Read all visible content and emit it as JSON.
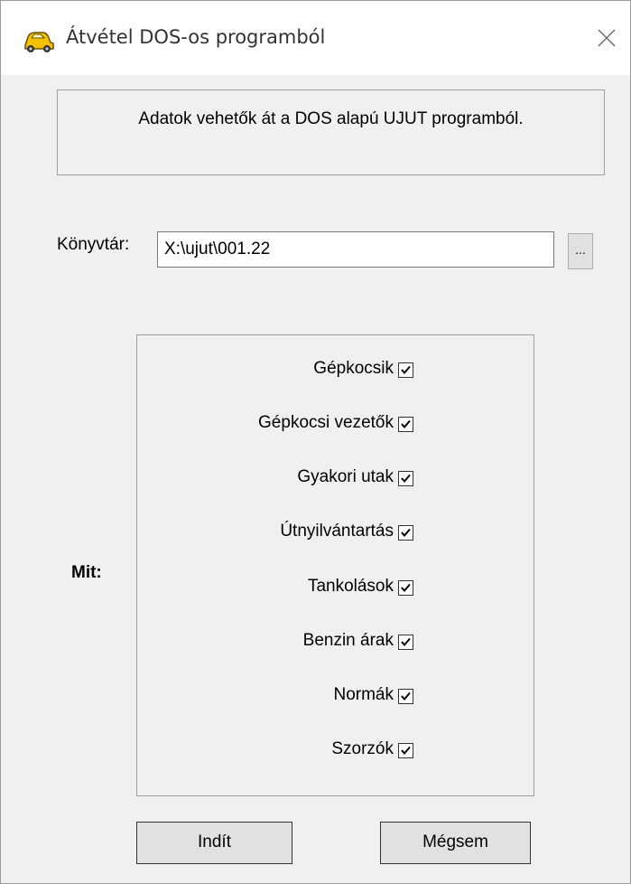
{
  "window": {
    "title": "Átvétel DOS-os programból",
    "app_icon": "car-icon",
    "close_icon": "close-icon"
  },
  "info": {
    "text": "Adatok vehetők át a DOS alapú UJUT programból."
  },
  "directory": {
    "label": "Könyvtár:",
    "value": "X:\\ujut\\001.22",
    "browse_label": "..."
  },
  "what": {
    "label": "Mit:"
  },
  "options": [
    {
      "label": "Gépkocsik",
      "checked": true
    },
    {
      "label": "Gépkocsi vezetők",
      "checked": true
    },
    {
      "label": "Gyakori utak",
      "checked": true
    },
    {
      "label": "Útnyilvántartás",
      "checked": true
    },
    {
      "label": "Tankolások",
      "checked": true
    },
    {
      "label": "Benzin árak",
      "checked": true
    },
    {
      "label": "Normák",
      "checked": true
    },
    {
      "label": "Szorzók",
      "checked": true
    }
  ],
  "buttons": {
    "start": "Indít",
    "cancel": "Mégsem"
  }
}
